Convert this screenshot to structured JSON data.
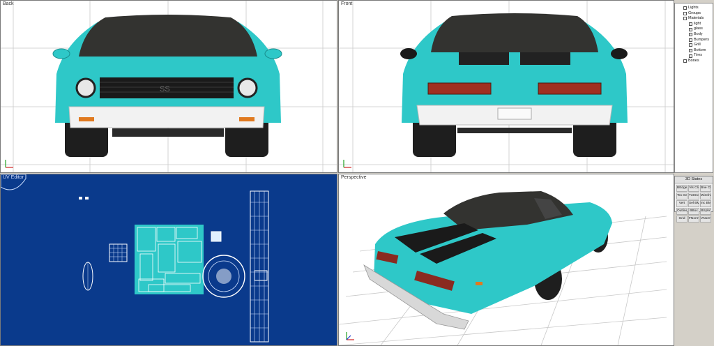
{
  "viewports": {
    "back": {
      "label": "Back"
    },
    "front": {
      "label": "Front"
    },
    "uv": {
      "label": "UV Editor"
    },
    "perspective": {
      "label": "Perspective"
    }
  },
  "grille_badge": "SS",
  "scene_tree": {
    "items": [
      {
        "label": "Lights",
        "level": 1
      },
      {
        "label": "Groups",
        "level": 1
      },
      {
        "label": "Materials",
        "level": 1
      },
      {
        "label": "light",
        "level": 2
      },
      {
        "label": "glass",
        "level": 2
      },
      {
        "label": "Body",
        "level": 2
      },
      {
        "label": "Bumpers",
        "level": 2
      },
      {
        "label": "Grill",
        "level": 2
      },
      {
        "label": "Bottom",
        "level": 2
      },
      {
        "label": "Tires",
        "level": 2
      },
      {
        "label": "Bones",
        "level": 1
      }
    ]
  },
  "states_panel": {
    "title": "3D States",
    "buttons": [
      "BEdge",
      "Vis Cli",
      "Bne Cli",
      "Tex Sw",
      "TxDrwH",
      "Wireframe",
      "Vert",
      "Sel BM",
      "Inc BM",
      "Outline",
      "BBox",
      "BSphr",
      "Grid",
      "FNorm",
      "VNorm"
    ]
  },
  "colors": {
    "car_body": "#2ec8c8",
    "uv_background": "#0a3a8c",
    "viewport_background": "#ffffff"
  }
}
